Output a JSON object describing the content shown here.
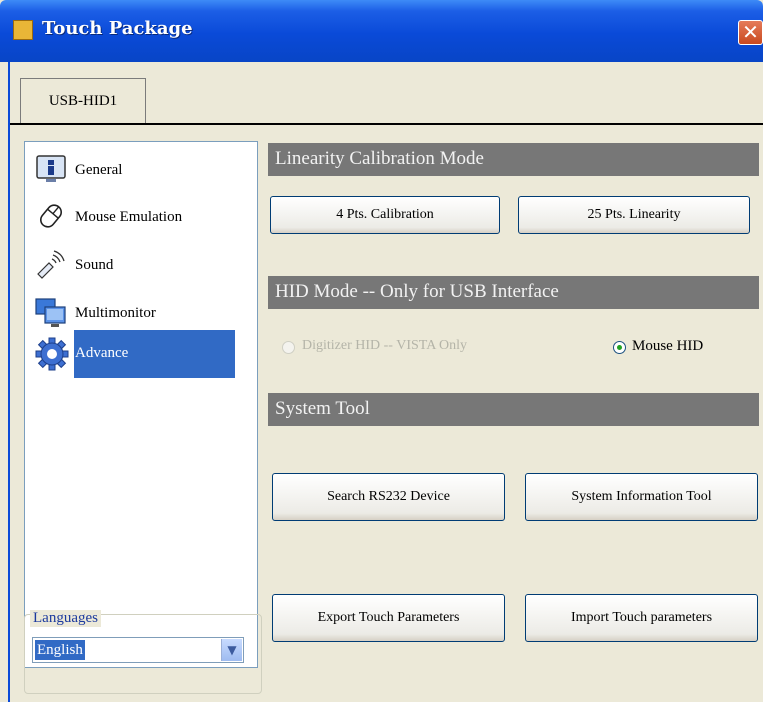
{
  "window": {
    "title": "Touch Package",
    "close_glyph": "✕"
  },
  "tabs": [
    {
      "label": "USB-HID1"
    }
  ],
  "sidebar": {
    "items": [
      {
        "label": "General",
        "icon": "info-icon"
      },
      {
        "label": "Mouse Emulation",
        "icon": "mouse-icon"
      },
      {
        "label": "Sound",
        "icon": "speaker-icon"
      },
      {
        "label": "Multimonitor",
        "icon": "monitors-icon"
      },
      {
        "label": "Advance",
        "icon": "gear-icon",
        "selected": true
      }
    ]
  },
  "languages": {
    "label": "Languages",
    "selected": "English",
    "arrow_glyph": "▼"
  },
  "main": {
    "linearity": {
      "heading": "Linearity Calibration Mode",
      "button_4pt": "4 Pts. Calibration",
      "button_25pt": "25 Pts. Linearity"
    },
    "hid": {
      "heading": "HID Mode -- Only for USB Interface",
      "digitizer_label": "Digitizer HID -- VISTA Only",
      "digitizer_enabled": false,
      "mouse_label": "Mouse HID",
      "mouse_selected": true
    },
    "system_tool": {
      "heading": "System Tool",
      "search_rs232": "Search RS232 Device",
      "system_info": "System Information Tool",
      "export_params": "Export Touch Parameters",
      "import_params": "Import Touch parameters"
    }
  },
  "colors": {
    "titlebar": "#0a4ad8",
    "section_header": "#777777",
    "selection": "#316ac5",
    "window_bg": "#ece9d8"
  }
}
